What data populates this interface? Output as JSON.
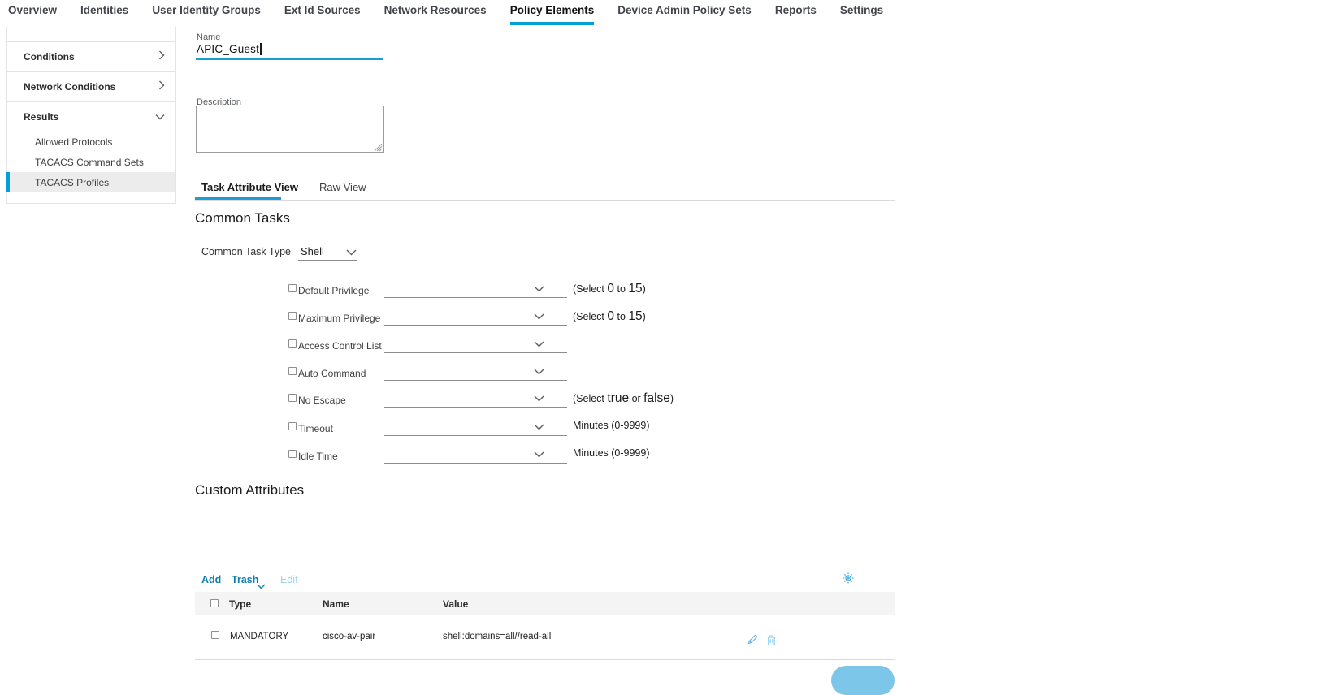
{
  "nav": {
    "items": [
      "Overview",
      "Identities",
      "User Identity Groups",
      "Ext Id Sources",
      "Network Resources",
      "Policy Elements",
      "Device Admin Policy Sets",
      "Reports",
      "Settings"
    ],
    "active_item": "Policy Elements"
  },
  "sidebar": {
    "conditions_label": "Conditions",
    "network_conditions_label": "Network Conditions",
    "results_label": "Results",
    "results_items": [
      "Allowed Protocols",
      "TACACS Command Sets",
      "TACACS Profiles"
    ],
    "selected_item": "TACACS Profiles"
  },
  "form": {
    "name_label": "Name",
    "name_value": "APIC_Guest",
    "description_label": "Description",
    "description_value": ""
  },
  "tabs": {
    "task_attribute_view": "Task Attribute View",
    "raw_view": "Raw View",
    "active": "Task Attribute View"
  },
  "common_tasks": {
    "heading": "Common Tasks",
    "task_type_label": "Common Task Type",
    "task_type_value": "Shell",
    "rows": [
      {
        "label": "Default Privilege",
        "value": "",
        "hint_pre": "(Select ",
        "hint_big1": "0",
        "hint_mid": " to ",
        "hint_big2": "15",
        "hint_post": ")"
      },
      {
        "label": "Maximum Privilege",
        "value": "",
        "hint_pre": "(Select ",
        "hint_big1": "0",
        "hint_mid": " to ",
        "hint_big2": "15",
        "hint_post": ")"
      },
      {
        "label": "Access Control List",
        "value": ""
      },
      {
        "label": "Auto Command",
        "value": ""
      },
      {
        "label": "No Escape",
        "value": "",
        "hint_pre": "(Select ",
        "hint_big1": "true",
        "hint_mid": " or ",
        "hint_big2": "false",
        "hint_post": ")"
      },
      {
        "label": "Timeout",
        "value": "",
        "hint_pre": "Minutes (0-9999)"
      },
      {
        "label": "Idle Time",
        "value": "",
        "hint_pre": "Minutes (0-9999)"
      }
    ]
  },
  "custom_attributes": {
    "heading": "Custom Attributes",
    "toolbar": {
      "add_label": "Add",
      "trash_label": "Trash",
      "edit_label": "Edit"
    },
    "table": {
      "col_type": "Type",
      "col_name": "Name",
      "col_value": "Value",
      "rows": [
        {
          "type": "MANDATORY",
          "name": "cisco-av-pair",
          "value": "shell:domains=all//read-all"
        }
      ]
    }
  },
  "colors": {
    "accent_blue": "#049fd9",
    "link_blue": "#0a7eb4",
    "disabled_link_blue": "#9bd9f3",
    "row_icon_blue": "#57b6e3",
    "save_button_blue": "#7cc6ea",
    "selected_item_bg": "#ececed",
    "table_header_bg": "#f4f4f5"
  }
}
